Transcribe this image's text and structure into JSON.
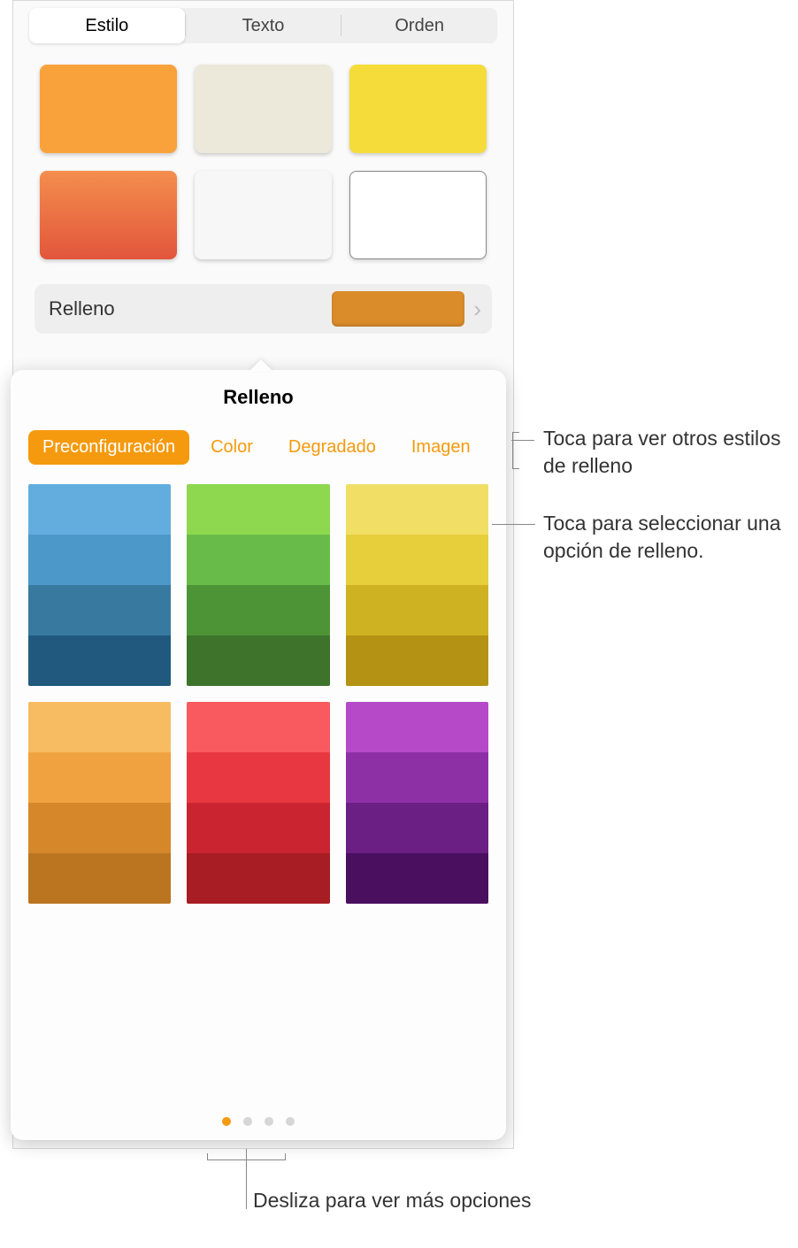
{
  "tabs": {
    "style": "Estilo",
    "text": "Texto",
    "order": "Orden"
  },
  "styles": [
    {
      "bg": "#f9a23c"
    },
    {
      "bg": "#ece8da"
    },
    {
      "bg": "#f5dc3a"
    },
    {
      "bg": "linear-gradient(180deg,#f48e4d,#e2563c)"
    },
    {
      "bg": "#f7f7f7"
    },
    {
      "bg": "#ffffff",
      "selected": true
    }
  ],
  "fillRow": {
    "label": "Relleno",
    "chipColor": "#da8c2a"
  },
  "popover": {
    "title": "Relleno",
    "tabs": [
      {
        "key": "preset",
        "label": "Preconfiguración",
        "active": true
      },
      {
        "key": "color",
        "label": "Color"
      },
      {
        "key": "gradient",
        "label": "Degradado"
      },
      {
        "key": "image",
        "label": "Imagen"
      }
    ],
    "presets": [
      [
        "#63adde",
        "#4b98c9",
        "#3879a0",
        "#20597d"
      ],
      [
        "#8dd84f",
        "#69bb49",
        "#4d9436",
        "#3d732b"
      ],
      [
        "#f1df65",
        "#e6cf3a",
        "#cfb221",
        "#b49214"
      ],
      [
        "#f7bb62",
        "#efa23f",
        "#d6872a",
        "#bb7520"
      ],
      [
        "#f85a5f",
        "#e83740",
        "#c92430",
        "#a81c23"
      ],
      [
        "#b549c8",
        "#8d30a5",
        "#6b1e83",
        "#4a0f5f"
      ]
    ],
    "pageDots": 4,
    "activeDot": 0
  },
  "callouts": {
    "tabs": "Toca para ver otros estilos de relleno",
    "swatch": "Toca para seleccionar una opción de relleno.",
    "pager": "Desliza para ver más opciones"
  }
}
